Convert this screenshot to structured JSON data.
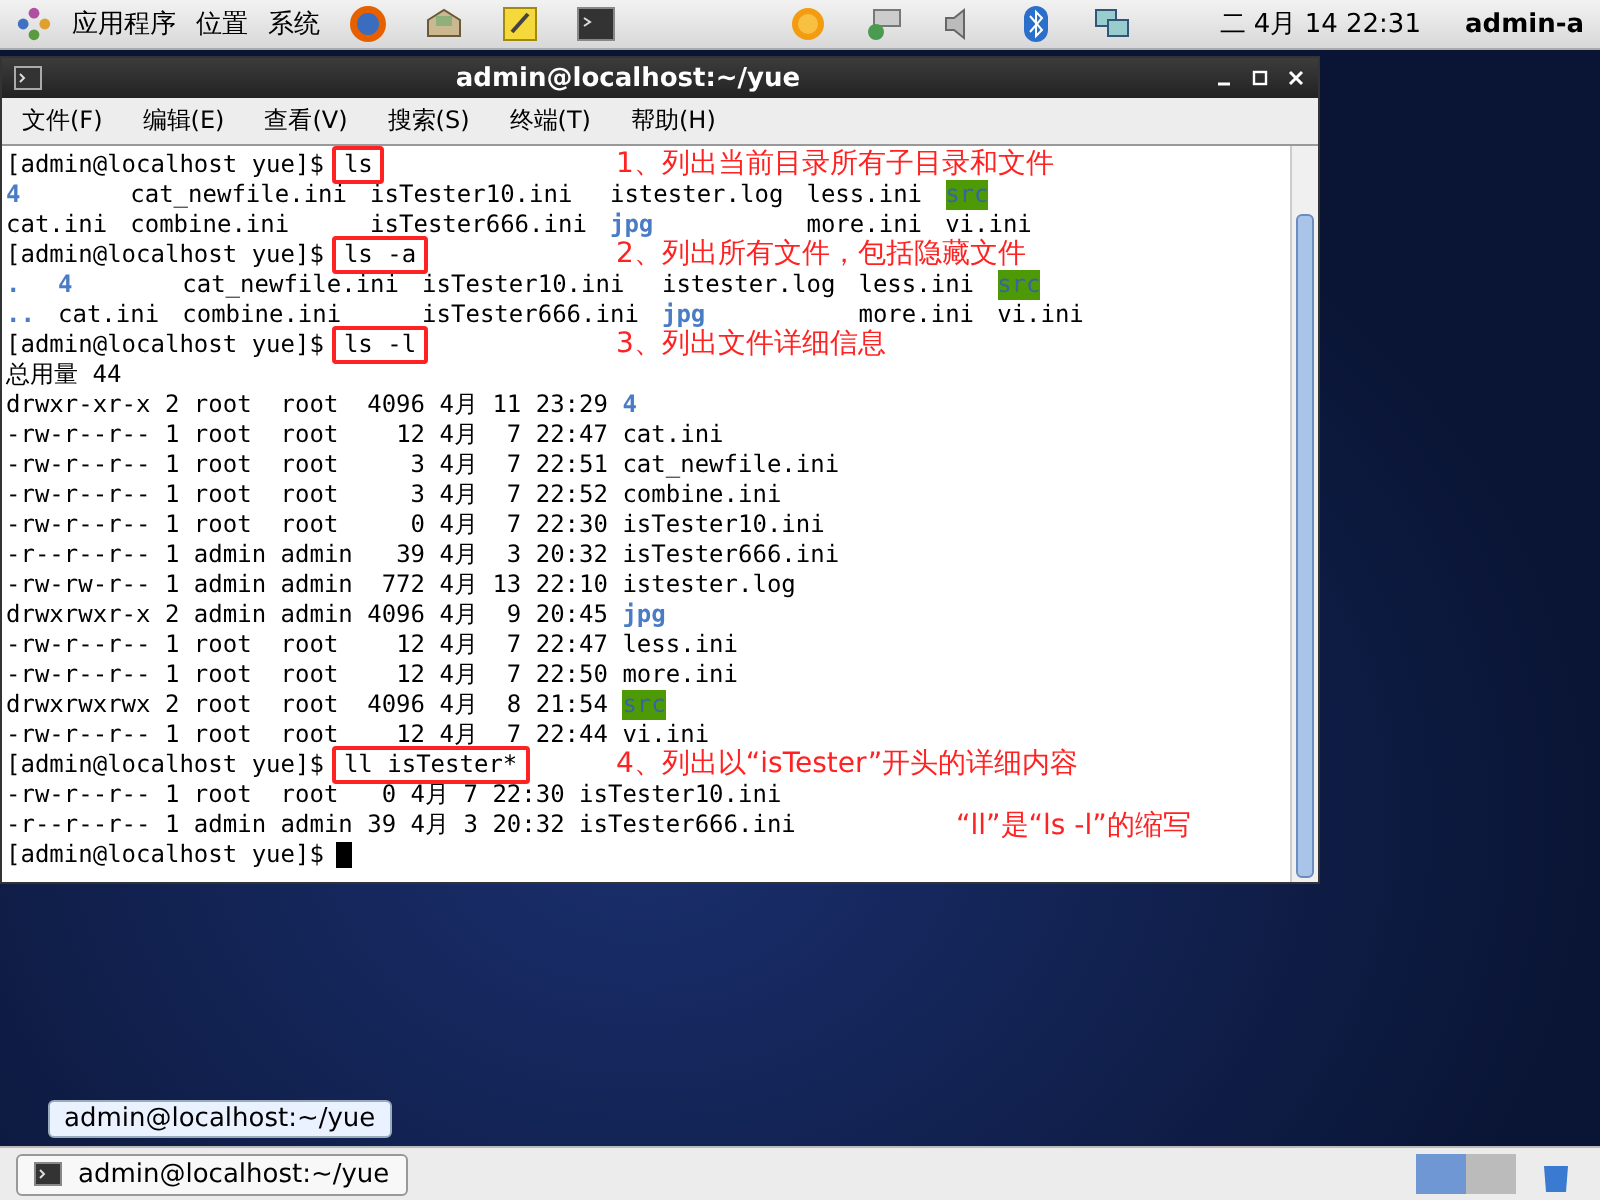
{
  "top_panel": {
    "menus": [
      "应用程序",
      "位置",
      "系统"
    ],
    "clock": "二 4月 14 22:31",
    "user": "admin-a"
  },
  "window": {
    "title": "admin@localhost:~/yue",
    "menu": [
      "文件(F)",
      "编辑(E)",
      "查看(V)",
      "搜索(S)",
      "终端(T)",
      "帮助(H)"
    ]
  },
  "terminal": [
    {
      "kind": "prompt",
      "prompt": "[admin@localhost yue]$",
      "command": "ls",
      "notes": [
        "1、列出当前目录所有子目录和文件"
      ]
    },
    {
      "kind": "grid",
      "rows": [
        [
          {
            "text": "4",
            "kind": "dir"
          },
          {
            "text": "cat_newfile.ini",
            "kind": "file"
          },
          {
            "text": "isTester10.ini",
            "kind": "file"
          },
          {
            "text": "istester.log",
            "kind": "file"
          },
          {
            "text": "less.ini",
            "kind": "file"
          },
          {
            "text": "src",
            "kind": "open"
          }
        ],
        [
          {
            "text": "cat.ini",
            "kind": "file"
          },
          {
            "text": "combine.ini",
            "kind": "file"
          },
          {
            "text": "isTester666.ini",
            "kind": "file"
          },
          {
            "text": "jpg",
            "kind": "dir"
          },
          {
            "text": "more.ini",
            "kind": "file"
          },
          {
            "text": "vi.ini",
            "kind": "file"
          }
        ]
      ]
    },
    {
      "kind": "prompt",
      "prompt": "[admin@localhost yue]$",
      "command": "ls -a",
      "notes": [
        "2、列出所有文件，包括隐藏文件"
      ]
    },
    {
      "kind": "grid",
      "rows": [
        [
          {
            "text": ".",
            "kind": "dir"
          },
          {
            "text": "4",
            "kind": "dir"
          },
          {
            "text": "cat_newfile.ini",
            "kind": "file"
          },
          {
            "text": "isTester10.ini",
            "kind": "file"
          },
          {
            "text": "istester.log",
            "kind": "file"
          },
          {
            "text": "less.ini",
            "kind": "file"
          },
          {
            "text": "src",
            "kind": "open"
          }
        ],
        [
          {
            "text": "..",
            "kind": "dir"
          },
          {
            "text": "cat.ini",
            "kind": "file"
          },
          {
            "text": "combine.ini",
            "kind": "file"
          },
          {
            "text": "isTester666.ini",
            "kind": "file"
          },
          {
            "text": "jpg",
            "kind": "dir"
          },
          {
            "text": "more.ini",
            "kind": "file"
          },
          {
            "text": "vi.ini",
            "kind": "file"
          }
        ]
      ]
    },
    {
      "kind": "prompt",
      "prompt": "[admin@localhost yue]$",
      "command": "ls -l",
      "notes": [
        "3、列出文件详细信息"
      ]
    },
    {
      "kind": "text",
      "text": "总用量 44"
    },
    {
      "kind": "long",
      "rows": [
        [
          "drwxr-xr-x",
          "2",
          "root",
          "root",
          "4096",
          "4月",
          "11",
          "23:29",
          {
            "text": "4",
            "kind": "dir"
          }
        ],
        [
          "-rw-r--r--",
          "1",
          "root",
          "root",
          "12",
          "4月",
          "7",
          "22:47",
          {
            "text": "cat.ini",
            "kind": "file"
          }
        ],
        [
          "-rw-r--r--",
          "1",
          "root",
          "root",
          "3",
          "4月",
          "7",
          "22:51",
          {
            "text": "cat_newfile.ini",
            "kind": "file"
          }
        ],
        [
          "-rw-r--r--",
          "1",
          "root",
          "root",
          "3",
          "4月",
          "7",
          "22:52",
          {
            "text": "combine.ini",
            "kind": "file"
          }
        ],
        [
          "-rw-r--r--",
          "1",
          "root",
          "root",
          "0",
          "4月",
          "7",
          "22:30",
          {
            "text": "isTester10.ini",
            "kind": "file"
          }
        ],
        [
          "-r--r--r--",
          "1",
          "admin",
          "admin",
          "39",
          "4月",
          "3",
          "20:32",
          {
            "text": "isTester666.ini",
            "kind": "file"
          }
        ],
        [
          "-rw-rw-r--",
          "1",
          "admin",
          "admin",
          "772",
          "4月",
          "13",
          "22:10",
          {
            "text": "istester.log",
            "kind": "file"
          }
        ],
        [
          "drwxrwxr-x",
          "2",
          "admin",
          "admin",
          "4096",
          "4月",
          "9",
          "20:45",
          {
            "text": "jpg",
            "kind": "dir"
          }
        ],
        [
          "-rw-r--r--",
          "1",
          "root",
          "root",
          "12",
          "4月",
          "7",
          "22:47",
          {
            "text": "less.ini",
            "kind": "file"
          }
        ],
        [
          "-rw-r--r--",
          "1",
          "root",
          "root",
          "12",
          "4月",
          "7",
          "22:50",
          {
            "text": "more.ini",
            "kind": "file"
          }
        ],
        [
          "drwxrwxrwx",
          "2",
          "root",
          "root",
          "4096",
          "4月",
          "8",
          "21:54",
          {
            "text": "src",
            "kind": "open"
          }
        ],
        [
          "-rw-r--r--",
          "1",
          "root",
          "root",
          "12",
          "4月",
          "7",
          "22:44",
          {
            "text": "vi.ini",
            "kind": "file"
          }
        ]
      ]
    },
    {
      "kind": "prompt",
      "prompt": "[admin@localhost yue]$",
      "command": "ll isTester*",
      "notes": [
        "4、列出以“isTester”开头的详细内容",
        "“ll”是“ls -l”的缩写"
      ]
    },
    {
      "kind": "long",
      "rows": [
        [
          "-rw-r--r--",
          "1",
          "root",
          "root",
          "0",
          "4月",
          "7",
          "22:30",
          {
            "text": "isTester10.ini",
            "kind": "file"
          }
        ],
        [
          "-r--r--r--",
          "1",
          "admin",
          "admin",
          "39",
          "4月",
          "3",
          "20:32",
          {
            "text": "isTester666.ini",
            "kind": "file"
          }
        ]
      ]
    },
    {
      "kind": "prompt",
      "prompt": "[admin@localhost yue]$",
      "cursor": true
    }
  ],
  "tooltip": "admin@localhost:~/yue",
  "taskbar": {
    "item": "admin@localhost:~/yue"
  }
}
